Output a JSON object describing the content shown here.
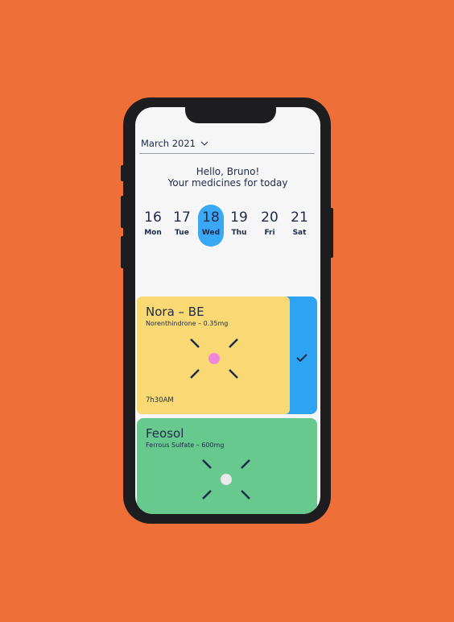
{
  "header": {
    "month_label": "March 2021",
    "greeting_line1": "Hello, Bruno!",
    "greeting_line2": "Your medicines for today"
  },
  "days": [
    {
      "num": "16",
      "name": "Mon",
      "active": false
    },
    {
      "num": "17",
      "name": "Tue",
      "active": false
    },
    {
      "num": "18",
      "name": "Wed",
      "active": true
    },
    {
      "num": "19",
      "name": "Thu",
      "active": false
    },
    {
      "num": "20",
      "name": "Fri",
      "active": false
    },
    {
      "num": "21",
      "name": "Sat",
      "active": false
    }
  ],
  "medicines": [
    {
      "name": "Nora – BE",
      "dose": "Norenthindrone – 0.35mg",
      "time": "7h30AM",
      "color": "#F8D974",
      "pill_color": "#EE86D9"
    },
    {
      "name": "Feosol",
      "dose": "Ferrous Sulfate – 600mg",
      "color": "#67C98E",
      "pill_color": "#E9E9E9"
    }
  ],
  "colors": {
    "background": "#EE6F38",
    "accent": "#3AA8F5",
    "text": "#1E2A4A"
  },
  "icons": {
    "month_dropdown": "chevron-down-icon",
    "taken": "checkmark-icon"
  }
}
